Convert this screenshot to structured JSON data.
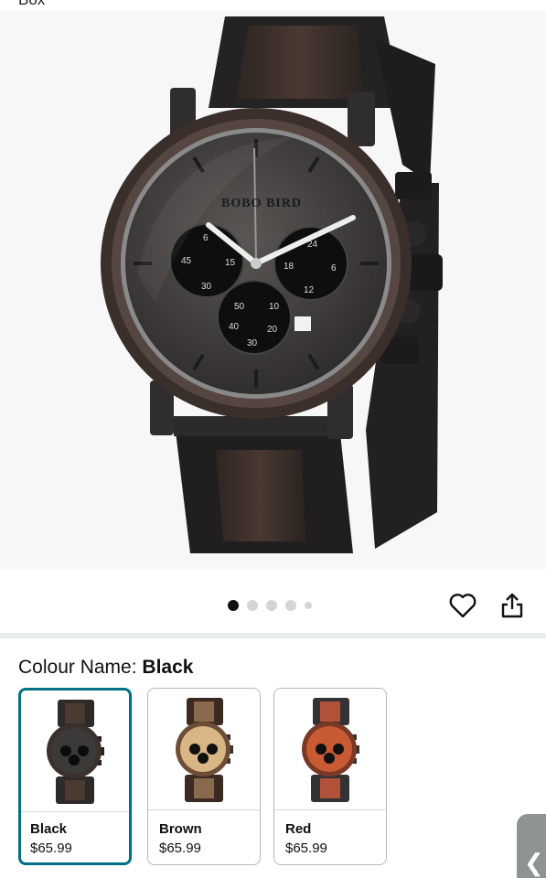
{
  "header": {
    "cropped_text": "Box"
  },
  "gallery": {
    "brand_text": "BOBO BIRD",
    "dial_numbers": {
      "left": [
        "6",
        "45",
        "15",
        "30"
      ],
      "right": [
        "24",
        "18",
        "6",
        "12"
      ],
      "bottom": [
        "50",
        "10",
        "40",
        "20",
        "30"
      ]
    },
    "dots": [
      {
        "active": true,
        "small": false
      },
      {
        "active": false,
        "small": false
      },
      {
        "active": false,
        "small": false
      },
      {
        "active": false,
        "small": false
      },
      {
        "active": false,
        "small": true
      }
    ],
    "heart_icon": "heart-outline-icon",
    "share_icon": "share-icon"
  },
  "colour": {
    "label": "Colour Name:",
    "selected": "Black",
    "options": [
      {
        "name": "Black",
        "price": "$65.99",
        "selected": true,
        "dial": "#3c3a38",
        "band": "#2e2a27",
        "inlay": "#4a3b32"
      },
      {
        "name": "Brown",
        "price": "$65.99",
        "selected": false,
        "dial": "#d8b685",
        "band": "#3a2a22",
        "inlay": "#8a6a4c"
      },
      {
        "name": "Red",
        "price": "$65.99",
        "selected": false,
        "dial": "#c85a34",
        "band": "#333",
        "inlay": "#b2523a"
      }
    ]
  },
  "colors": {
    "accent": "#007185",
    "tab": "#8e9494"
  },
  "side_tab": {
    "glyph": "❮"
  }
}
